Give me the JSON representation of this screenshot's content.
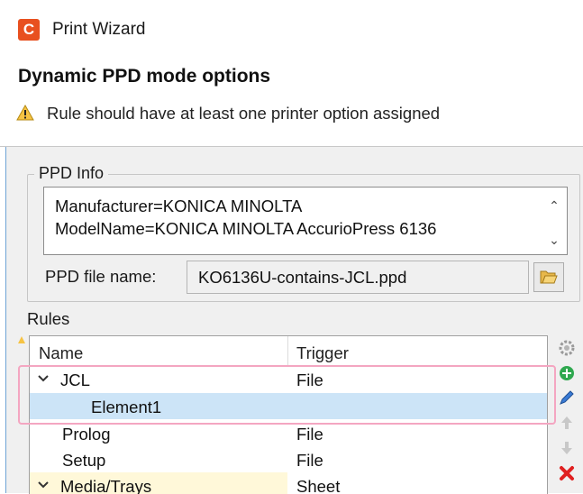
{
  "window": {
    "app_icon": "C",
    "title": "Print Wizard"
  },
  "header": {
    "title": "Dynamic PPD mode options",
    "warning_icon": "warning-triangle-icon",
    "warning": "Rule should have at least one printer option assigned"
  },
  "ppd_info": {
    "group_label": "PPD Info",
    "lines": [
      "Manufacturer=KONICA MINOLTA",
      "ModelName=KONICA MINOLTA AccurioPress 6136"
    ],
    "file_label": "PPD file name:",
    "file_value": "KO6136U-contains-JCL.ppd",
    "browse_icon": "folder-open-icon"
  },
  "rules": {
    "label": "Rules",
    "columns": [
      "Name",
      "Trigger"
    ],
    "rows": [
      {
        "name": "JCL",
        "trigger": "File",
        "expanded": true
      },
      {
        "name": "Element1",
        "trigger": ""
      },
      {
        "name": "Prolog",
        "trigger": "File"
      },
      {
        "name": "Setup",
        "trigger": "File"
      },
      {
        "name": "Media/Trays",
        "trigger": "Sheet",
        "expanded": true
      }
    ],
    "tools": [
      "settings-gear-icon",
      "add-icon",
      "edit-pencil-icon",
      "move-up-icon",
      "move-down-icon",
      "delete-icon"
    ]
  },
  "colors": {
    "accent": "#e8501f",
    "selection": "#cce4f7",
    "highlight_outline": "#f4a6c1",
    "delete": "#e02020",
    "add": "#2fa84f"
  }
}
